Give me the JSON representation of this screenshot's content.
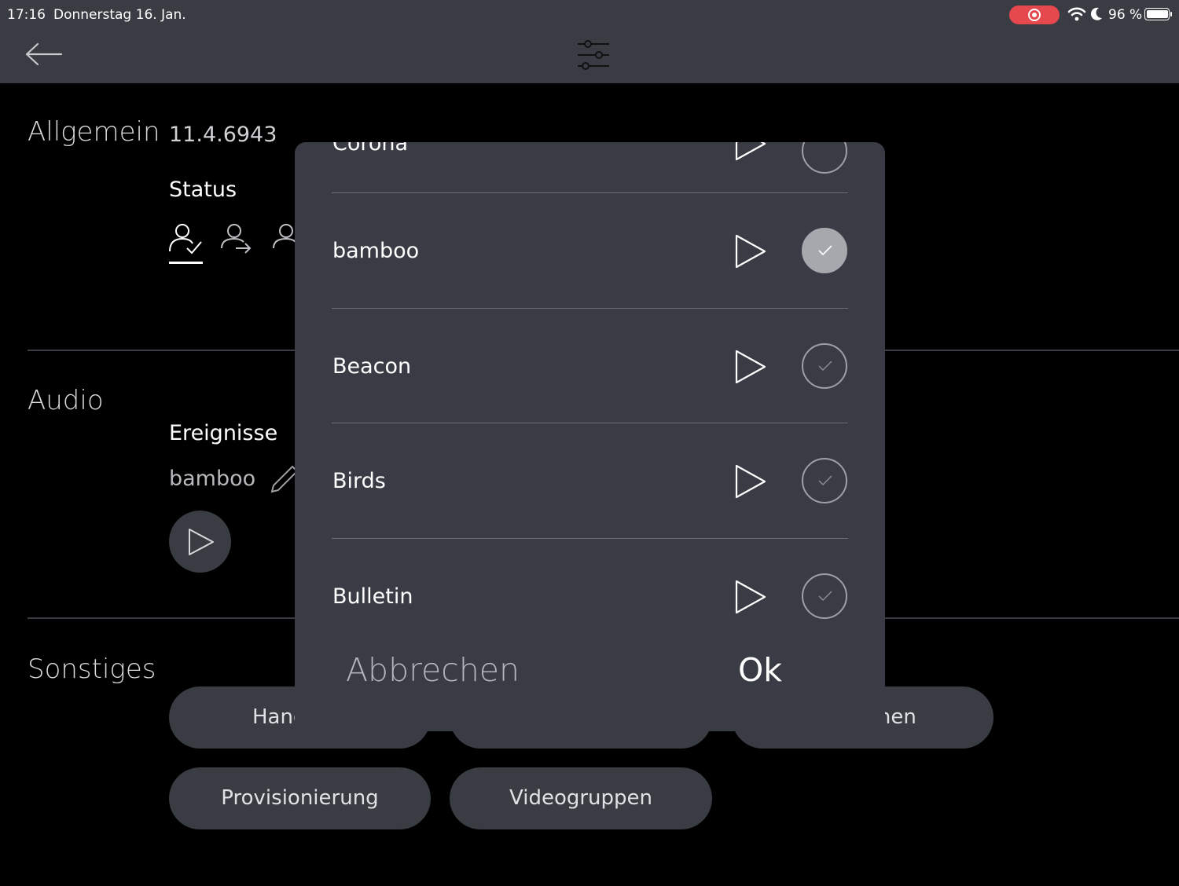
{
  "statusbar": {
    "time": "17:16",
    "date": "Donnerstag 16. Jan.",
    "battery": "96 %",
    "battery_level": 0.96,
    "icons": [
      "screen-recording-icon",
      "wifi-icon",
      "moon-icon",
      "battery-icon"
    ]
  },
  "navbar": {
    "icons": [
      "back-arrow-icon",
      "filter-sliders-icon"
    ]
  },
  "general": {
    "title": "Allgemein",
    "version": "11.4.6943",
    "status_label": "Status",
    "status_icons": [
      "user-available-icon",
      "user-forward-icon",
      "user-away-icon"
    ]
  },
  "audio": {
    "title": "Audio",
    "events_label": "Ereignisse",
    "current_sound": "bamboo"
  },
  "other": {
    "title": "Sonstiges",
    "buttons_row1": [
      "Hand",
      "",
      "onen"
    ],
    "buttons_row2": [
      "Provisionierung",
      "Videogruppen"
    ]
  },
  "dialog": {
    "partial_top_label": "Corona",
    "items": [
      {
        "label": "bamboo",
        "selected": true
      },
      {
        "label": "Beacon",
        "selected": false
      },
      {
        "label": "Birds",
        "selected": false
      },
      {
        "label": "Bulletin",
        "selected": false
      }
    ],
    "cancel_label": "Abbrechen",
    "ok_label": "Ok"
  },
  "colors": {
    "background": "#000000",
    "surface": "#3a3c43",
    "dialog": "#3a3c45",
    "recording": "#e5484d",
    "check_selected": "#a6a8ae"
  }
}
